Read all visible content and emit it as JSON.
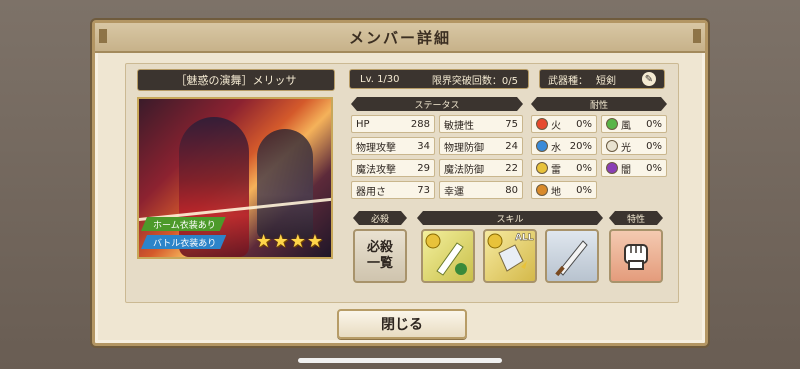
{
  "window": {
    "title": "メンバー詳細"
  },
  "character": {
    "name": "［魅惑の演舞］メリッサ",
    "tags": {
      "home": "ホーム衣装あり",
      "battle": "バトル衣装あり"
    },
    "stars": [
      "★",
      "★",
      "★",
      "★"
    ],
    "star_count": 4
  },
  "level": {
    "label": "Lv. 1/30",
    "limit_break": "限界突破回数：0/5"
  },
  "weapon": {
    "label": "武器種：",
    "value": "短剣",
    "icon": "wrench-icon"
  },
  "headers": {
    "status": "ステータス",
    "resist": "耐性",
    "special": "必殺",
    "skill": "スキル",
    "trait": "特性"
  },
  "stats": [
    {
      "label": "HP",
      "value": "288"
    },
    {
      "label": "敏捷性",
      "value": "75"
    },
    {
      "label": "物理攻撃",
      "value": "34"
    },
    {
      "label": "物理防御",
      "value": "24"
    },
    {
      "label": "魔法攻撃",
      "value": "29"
    },
    {
      "label": "魔法防御",
      "value": "22"
    },
    {
      "label": "器用さ",
      "value": "73"
    },
    {
      "label": "幸運",
      "value": "80"
    }
  ],
  "resistances": [
    {
      "label": "火",
      "value": "0%",
      "color": "#e64a2e"
    },
    {
      "label": "風",
      "value": "0%",
      "color": "#59b548"
    },
    {
      "label": "水",
      "value": "20%",
      "color": "#3a8ad8"
    },
    {
      "label": "光",
      "value": "0%",
      "color": "#e8e2d0"
    },
    {
      "label": "雷",
      "value": "0%",
      "color": "#e8c23a"
    },
    {
      "label": "闇",
      "value": "0%",
      "color": "#8a3fb5"
    },
    {
      "label": "地",
      "value": "0%",
      "color": "#d98a2a"
    }
  ],
  "special_button": "必殺\n一覧",
  "skill_all": "ALL",
  "close": "閉じる",
  "colors": {
    "panel": "#efe6d2",
    "dark_label": "#3b342f",
    "arrow": "#e04a9a",
    "gold": "#b79c66"
  }
}
